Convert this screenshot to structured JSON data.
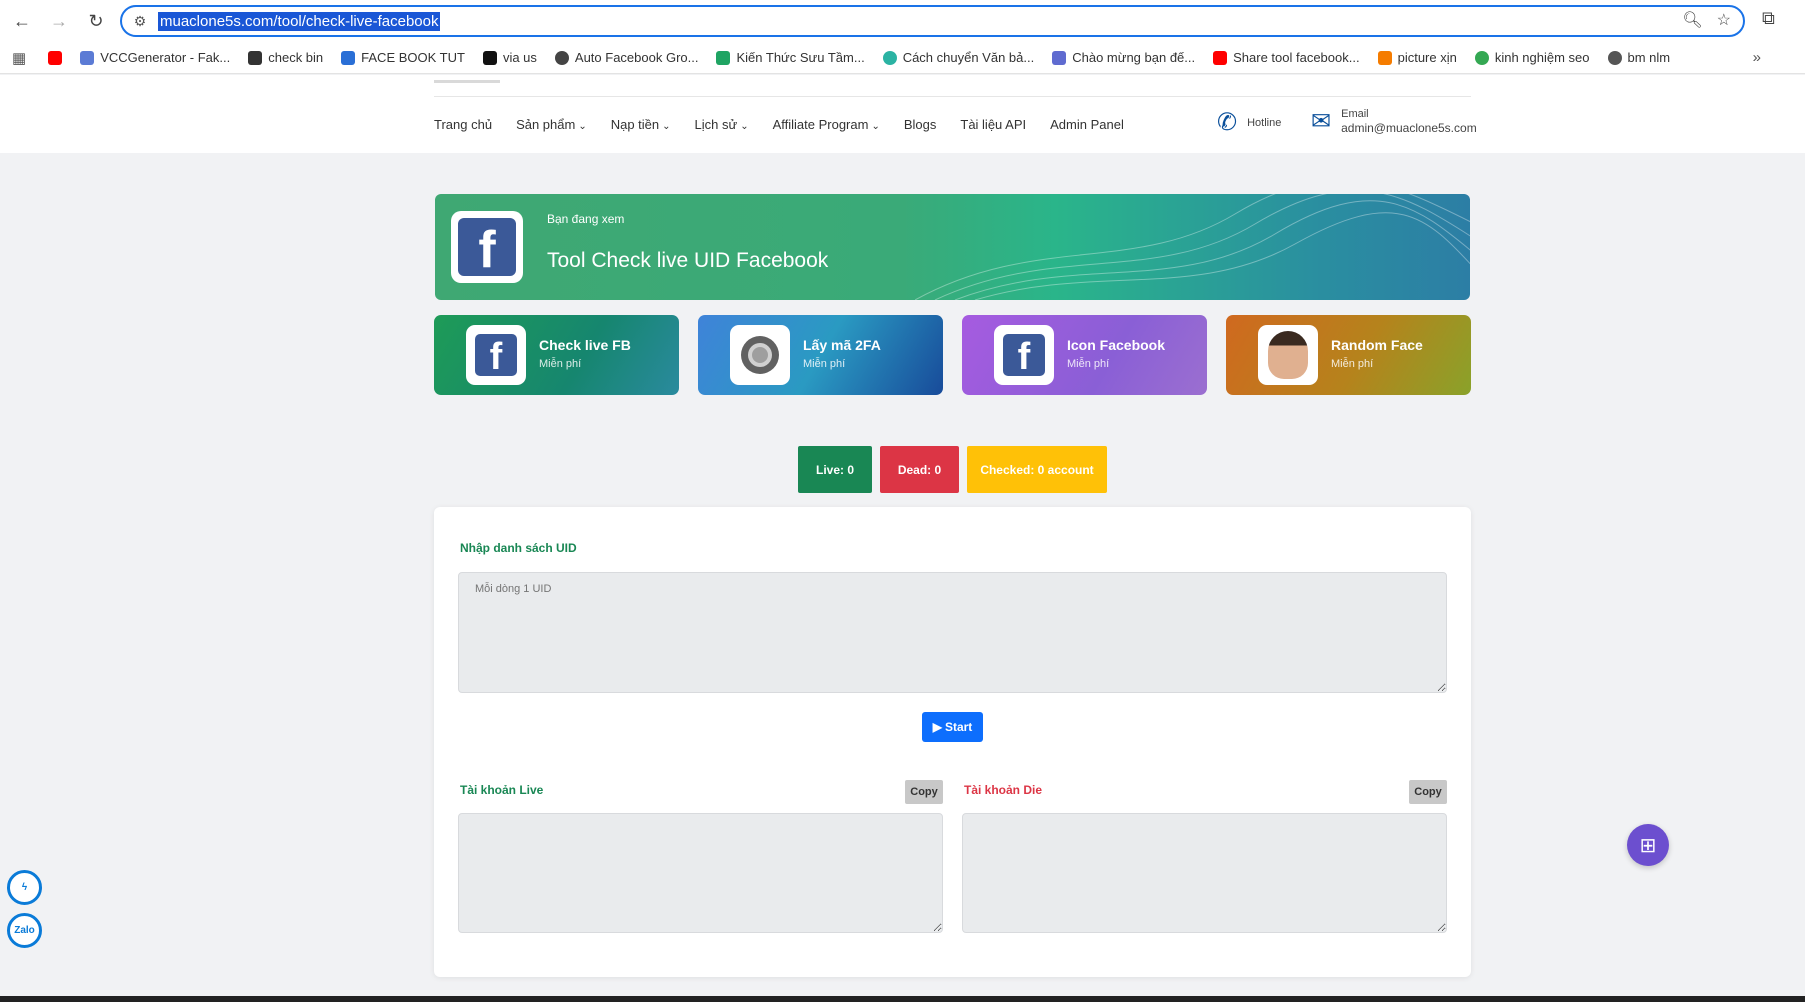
{
  "browser": {
    "url": "muaclone5s.com/tool/check-live-facebook",
    "bookmarks": [
      {
        "label": "",
        "color": "#ff0000"
      },
      {
        "label": "VCCGenerator - Fak...",
        "color": "#5b7bd5"
      },
      {
        "label": "check bin",
        "color": "#333333"
      },
      {
        "label": "FACE BOOK TUT",
        "color": "#2a6fd6"
      },
      {
        "label": "via us",
        "color": "#111111"
      },
      {
        "label": "Auto Facebook Gro...",
        "color": "#444444"
      },
      {
        "label": "Kiến Thức Sưu Tầm...",
        "color": "#1fa463"
      },
      {
        "label": "Cách chuyển Văn bả...",
        "color": "#2bb3a3"
      },
      {
        "label": "Chào mừng bạn đế...",
        "color": "#5f6bd0"
      },
      {
        "label": "Share tool facebook...",
        "color": "#ff0000"
      },
      {
        "label": "picture xịn",
        "color": "#f57c00"
      },
      {
        "label": "kinh nghiệm seo",
        "color": "#34a853"
      },
      {
        "label": "bm nlm",
        "color": "#555555"
      }
    ]
  },
  "header": {
    "menu": [
      {
        "label": "Trang chủ",
        "dropdown": false
      },
      {
        "label": "Sản phẩm",
        "dropdown": true
      },
      {
        "label": "Nạp tiền",
        "dropdown": true
      },
      {
        "label": "Lịch sử",
        "dropdown": true
      },
      {
        "label": "Affiliate Program",
        "dropdown": true
      },
      {
        "label": "Blogs",
        "dropdown": false
      },
      {
        "label": "Tài liệu API",
        "dropdown": false
      },
      {
        "label": "Admin Panel",
        "dropdown": false
      }
    ],
    "hotline_label": "Hotline",
    "email_label": "Email",
    "email_value": "admin@muaclone5s.com"
  },
  "banner": {
    "subtitle": "Bạn đang xem",
    "title": "Tool Check live UID Facebook"
  },
  "tools": [
    {
      "title": "Check live FB",
      "sub": "Miễn phí",
      "icon": "facebook-icon"
    },
    {
      "title": "Lấy mã 2FA",
      "sub": "Miễn phí",
      "icon": "authenticator-icon"
    },
    {
      "title": "Icon Facebook",
      "sub": "Miễn phí",
      "icon": "facebook-icon"
    },
    {
      "title": "Random Face",
      "sub": "Miễn phí",
      "icon": "face-icon"
    }
  ],
  "stats": {
    "live": "Live: 0",
    "dead": "Dead: 0",
    "checked": "Checked: 0 account"
  },
  "form": {
    "uid_label": "Nhập danh sách UID",
    "uid_placeholder": "Mỗi dòng 1 UID",
    "start_label": "Start",
    "live_label": "Tài khoản Live",
    "die_label": "Tài khoản Die",
    "copy_label": "Copy"
  },
  "side": {
    "messenger": "messenger-icon",
    "zalo": "Zalo"
  },
  "colors": {
    "green": "#198754",
    "red": "#dc3545",
    "yellow": "#ffc107",
    "blue": "#0d6efd",
    "facebook": "#3b5998"
  }
}
